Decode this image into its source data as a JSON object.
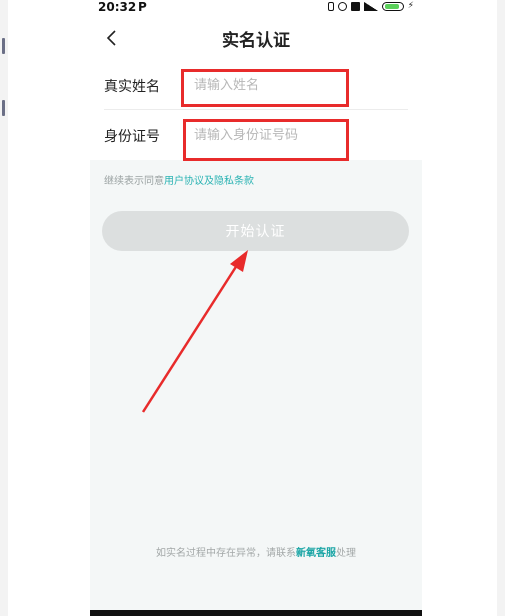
{
  "status_bar": {
    "time": "20:32",
    "app_indicator": "P",
    "icons": [
      "bluetooth-icon",
      "alarm-icon",
      "nfc-icon",
      "signal-icon",
      "battery-icon",
      "charging-icon"
    ]
  },
  "header": {
    "title": "实名认证",
    "back_icon": "chevron-left-icon"
  },
  "form": {
    "name_label": "真实姓名",
    "name_placeholder": "请输入姓名",
    "name_value": "",
    "id_label": "身份证号",
    "id_placeholder": "请输入身份证号码",
    "id_value": ""
  },
  "agreement": {
    "prefix": "继续表示同意",
    "link_text": "用户协议及隐私条款"
  },
  "start_button": {
    "label": "开始认证"
  },
  "footer": {
    "prefix": "如实名过程中存在异常，请联系",
    "link_text": "新氧客服",
    "suffix": "处理"
  },
  "colors": {
    "annotation_red": "#e82b2b",
    "link_teal": "#2ab3b3",
    "button_disabled": "#dcdfdf",
    "page_background": "#f4f7f7"
  }
}
